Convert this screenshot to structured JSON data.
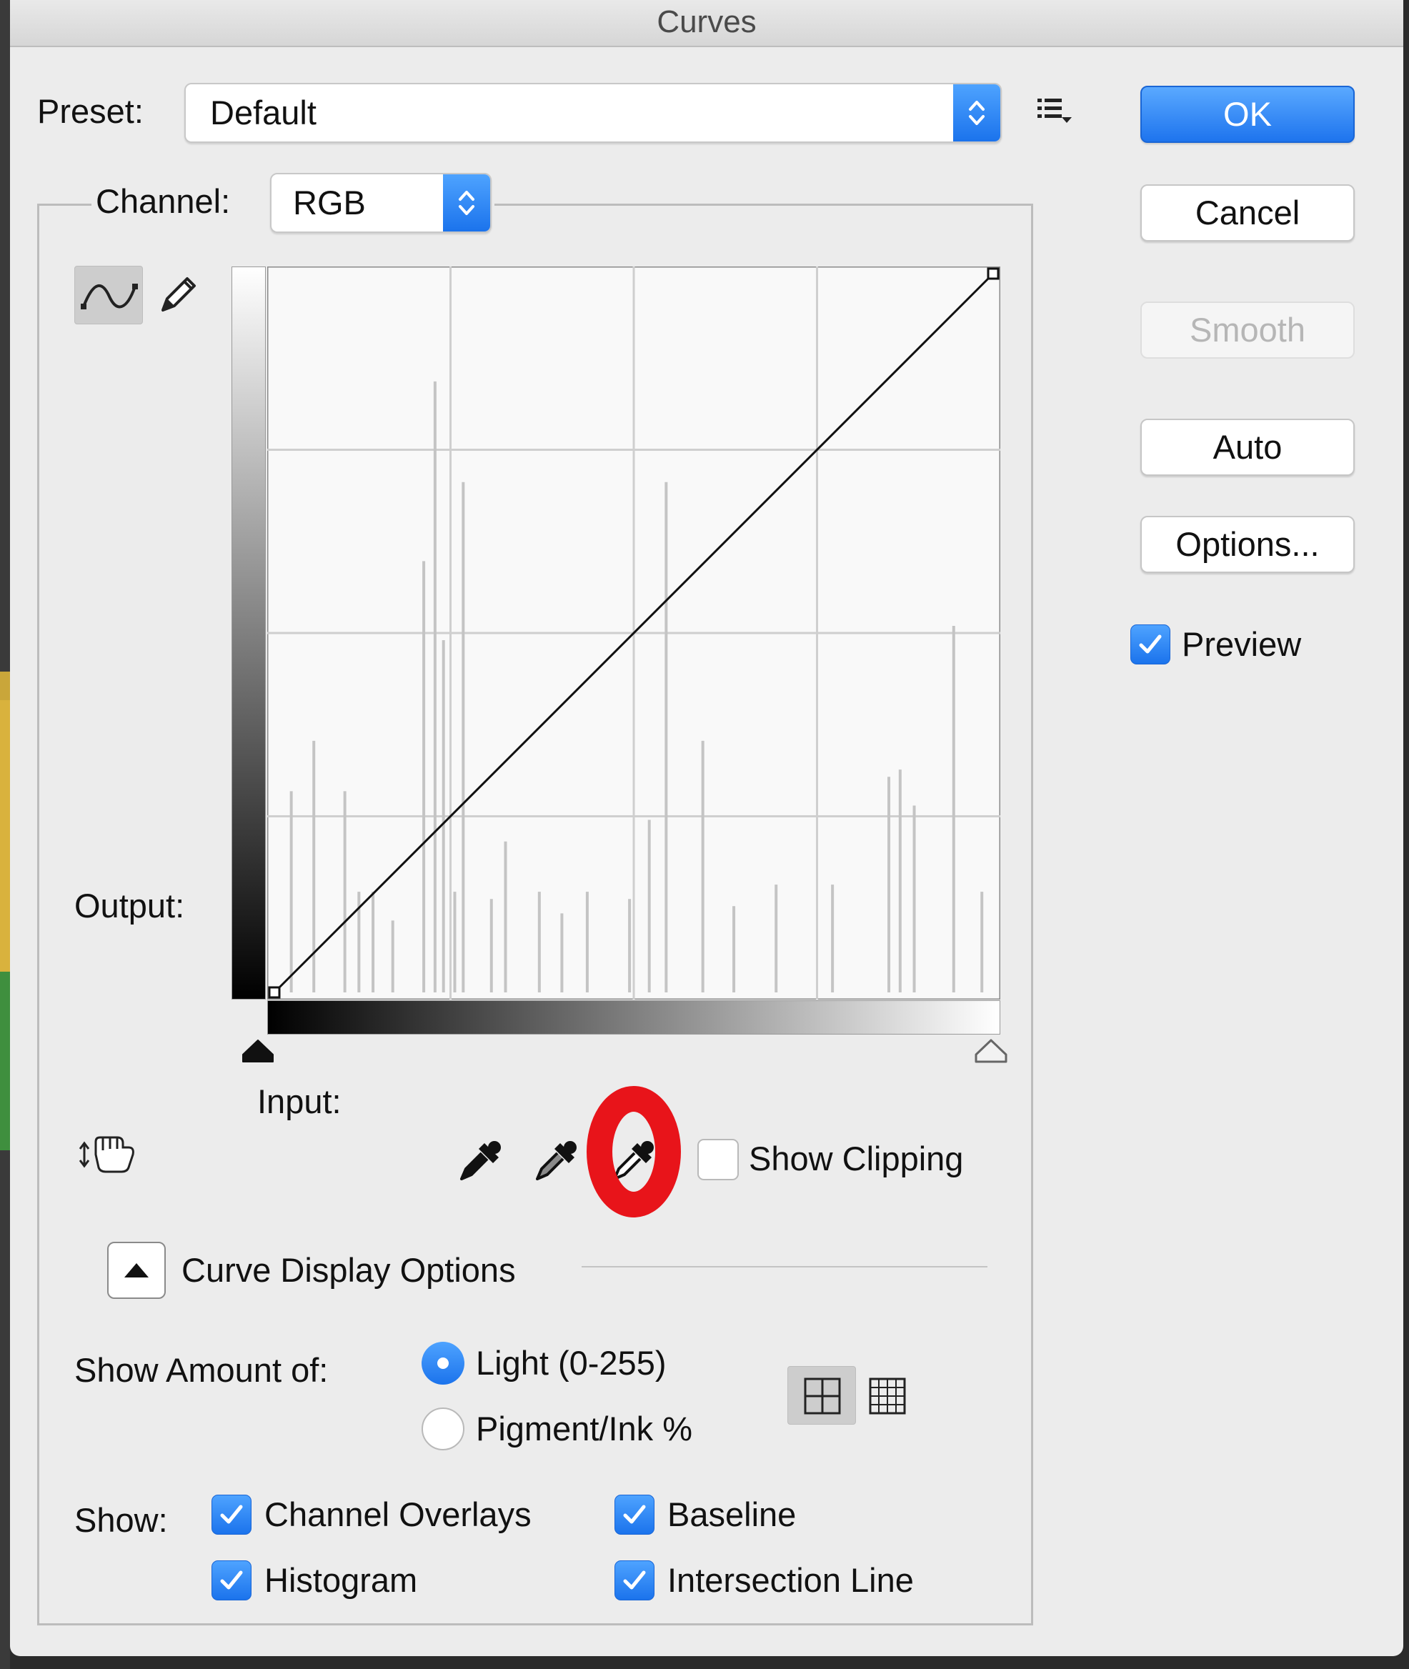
{
  "window": {
    "title": "Curves"
  },
  "preset": {
    "label": "Preset:",
    "value": "Default"
  },
  "channel": {
    "label": "Channel:",
    "value": "RGB"
  },
  "buttons": {
    "ok": "OK",
    "cancel": "Cancel",
    "smooth": "Smooth",
    "auto": "Auto",
    "options": "Options..."
  },
  "preview": {
    "label": "Preview",
    "checked": true
  },
  "graph": {
    "output_label": "Output:",
    "input_label": "Input:",
    "curve_points": [
      [
        0,
        0
      ],
      [
        255,
        255
      ]
    ],
    "histogram_peaks": [
      [
        6,
        28
      ],
      [
        14,
        35
      ],
      [
        25,
        28
      ],
      [
        30,
        14
      ],
      [
        35,
        14
      ],
      [
        42,
        10
      ],
      [
        53,
        60
      ],
      [
        57,
        85
      ],
      [
        60,
        49
      ],
      [
        64,
        14
      ],
      [
        67,
        71
      ],
      [
        77,
        13
      ],
      [
        82,
        21
      ],
      [
        94,
        14
      ],
      [
        102,
        11
      ],
      [
        111,
        14
      ],
      [
        126,
        13
      ],
      [
        133,
        24
      ],
      [
        139,
        71
      ],
      [
        152,
        35
      ],
      [
        163,
        12
      ],
      [
        178,
        15
      ],
      [
        198,
        15
      ],
      [
        218,
        30
      ],
      [
        222,
        31
      ],
      [
        227,
        26
      ],
      [
        241,
        51
      ],
      [
        251,
        14
      ]
    ]
  },
  "eyedroppers": [
    "black-point",
    "gray-point",
    "white-point"
  ],
  "show_clipping": {
    "label": "Show Clipping",
    "checked": false
  },
  "annotation": {
    "color": "#e8141a"
  },
  "display_options": {
    "title": "Curve Display Options",
    "show_amount_label": "Show Amount of:",
    "light_label": "Light  (0-255)",
    "pigment_label": "Pigment/Ink %",
    "selected": "light",
    "grid": "simple"
  },
  "show": {
    "label": "Show:",
    "channel_overlays": "Channel Overlays",
    "baseline": "Baseline",
    "histogram": "Histogram",
    "intersection_line": "Intersection Line"
  },
  "colors": {
    "accent": "#1b73ec",
    "dialog_bg": "#ececec"
  }
}
